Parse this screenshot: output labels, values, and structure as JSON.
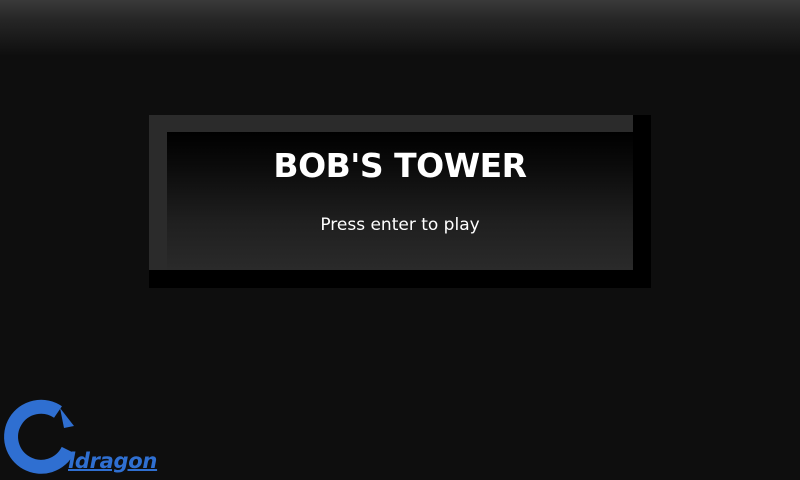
{
  "title_screen": {
    "game_title": "BOB'S TOWER",
    "prompt": "Press enter to play"
  },
  "logo": {
    "icon": "ring-logo-icon",
    "text": "ldragon",
    "color": "#2f6fd1"
  },
  "colors": {
    "background": "#0e0e0e",
    "panel_bevel": "#2b2b2b",
    "text": "#ffffff"
  }
}
